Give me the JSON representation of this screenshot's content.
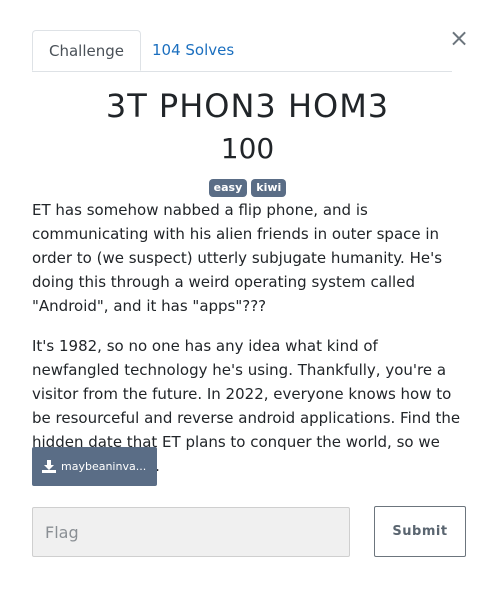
{
  "modal": {
    "close_label": "×"
  },
  "tabs": [
    {
      "label": "Challenge",
      "active": true
    },
    {
      "label": "104 Solves",
      "active": false
    }
  ],
  "challenge": {
    "title": "3T PHON3 HOM3",
    "points": "100",
    "tags": [
      "easy",
      "kiwi"
    ],
    "description": [
      "ET has somehow nabbed a flip phone, and is communicating with his alien friends in outer space in order to (we suspect) utterly subjugate humanity. He's doing this through a weird operating system called \"Android\", and it has \"apps\"???",
      "It's 1982, so no one has any idea what kind of newfangled technology he's using. Thankfully, you're a visitor from the future. In 2022, everyone knows how to be resourceful and reverse android applications. Find the hidden date that ET plans to conquer the world, so we can be prepared."
    ],
    "file_label": "maybeaninva...",
    "file_icon": "download-icon"
  },
  "submission": {
    "flag_placeholder": "Flag",
    "flag_value": "",
    "submit_label": "Submit"
  },
  "colors": {
    "tab_link": "#1b6fbf",
    "tag_bg": "#5a6d86",
    "file_btn_bg": "#5a6d86",
    "input_bg": "#f0f0f0"
  }
}
